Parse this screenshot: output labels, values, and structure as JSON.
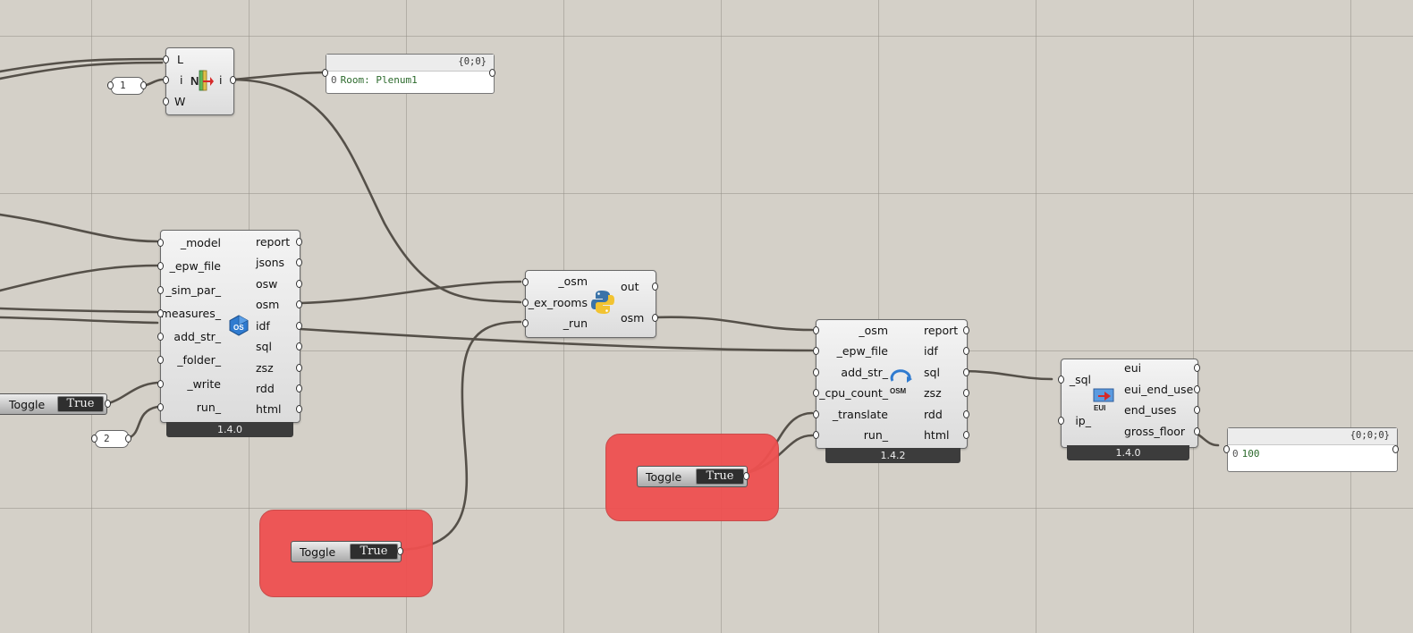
{
  "list_item": {
    "inputs": [
      "L",
      "i",
      "W"
    ],
    "output": "i",
    "index_value": "1"
  },
  "room_panel": {
    "path": "{0;0}",
    "index": "0",
    "value": "Room: Plenum1"
  },
  "model_to_osm": {
    "inputs": [
      "_model",
      "_epw_file",
      "_sim_par_",
      "measures_",
      "add_str_",
      "_folder_",
      "_write",
      "run_"
    ],
    "outputs": [
      "report",
      "jsons",
      "osw",
      "osm",
      "idf",
      "sql",
      "zsz",
      "rdd",
      "html"
    ],
    "version": "1.4.0",
    "icon": "openstudio-icon"
  },
  "left_toggle": {
    "label": "Toggle",
    "value": "True"
  },
  "run_value": "2",
  "python_comp": {
    "inputs": [
      "_osm",
      "_ex_rooms",
      "_run"
    ],
    "outputs": [
      "out",
      "osm"
    ],
    "icon": "python-icon"
  },
  "bottom_toggle": {
    "label": "Toggle",
    "value": "True"
  },
  "middle_toggle": {
    "label": "Toggle",
    "value": "True"
  },
  "run_osm": {
    "inputs": [
      "_osm",
      "_epw_file",
      "add_str_",
      "_cpu_count_",
      "_translate",
      "run_"
    ],
    "outputs": [
      "report",
      "idf",
      "sql",
      "zsz",
      "rdd",
      "html"
    ],
    "version": "1.4.2",
    "icon": "osm-icon",
    "icon_text": "OSM"
  },
  "eui_comp": {
    "inputs": [
      "_sql",
      "ip_"
    ],
    "outputs": [
      "eui",
      "eui_end_use",
      "end_uses",
      "gross_floor"
    ],
    "version": "1.4.0",
    "icon": "eui-icon",
    "icon_text": "EUI"
  },
  "result_panel": {
    "path": "{0;0;0}",
    "index": "0",
    "value": "100"
  },
  "colors": {
    "canvas": "#d4d0c8",
    "group": "#ef5050",
    "wire": "#4a4a4a",
    "version_bar": "#3c3c3c"
  }
}
